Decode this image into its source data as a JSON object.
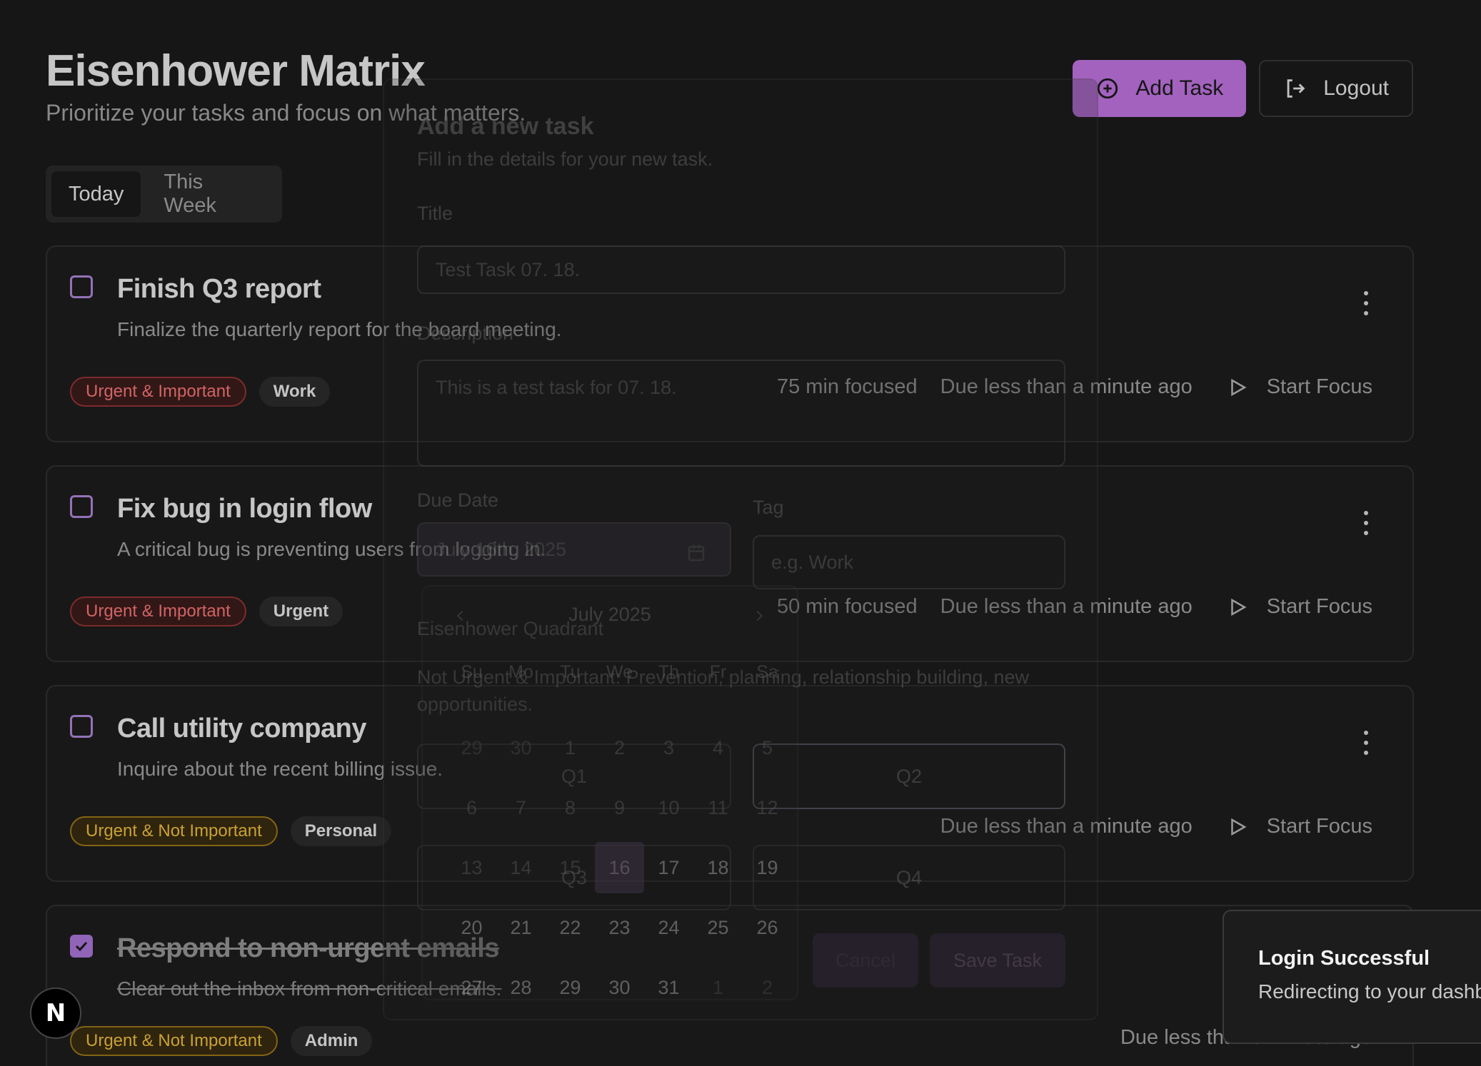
{
  "header": {
    "title": "Eisenhower Matrix",
    "subtitle": "Prioritize your tasks and focus on what matters.",
    "add_task_label": "Add Task",
    "logout_label": "Logout"
  },
  "tabs": [
    {
      "label": "Today",
      "active": true
    },
    {
      "label": "This Week",
      "active": false
    }
  ],
  "tasks": [
    {
      "title": "Finish Q3 report",
      "description": "Finalize the quarterly report for the board meeting.",
      "quadrant": "Urgent & Important",
      "tag": "Work",
      "focused": "75 min focused",
      "due": "Due less than a minute ago",
      "action": "Start Focus",
      "done": false
    },
    {
      "title": "Fix bug in login flow",
      "description": "A critical bug is preventing users from logging in.",
      "quadrant": "Urgent & Important",
      "tag": "Urgent",
      "focused": "50 min focused",
      "due": "Due less than a minute ago",
      "action": "Start Focus",
      "done": false
    },
    {
      "title": "Call utility company",
      "description": "Inquire about the recent billing issue.",
      "quadrant": "Urgent & Not Important",
      "tag": "Personal",
      "focused": "",
      "due": "Due less than a minute ago",
      "action": "Start Focus",
      "done": false
    },
    {
      "title": "Respond to non-urgent emails",
      "description": "Clear out the inbox from non-critical emails.",
      "quadrant": "Urgent & Not Important",
      "tag": "Admin",
      "due": "Due less than a minute ago",
      "done": true
    }
  ],
  "dialog": {
    "title": "Add a new task",
    "subtitle": "Fill in the details for your new task.",
    "title_label": "Title",
    "title_value": "Test Task 07. 18.",
    "description_label": "Description",
    "description_value": "This is a test task for 07. 18.",
    "due_date_label": "Due Date",
    "due_date_value": "July 16th, 2025",
    "tag_label": "Tag",
    "tag_placeholder": "e.g. Work",
    "quadrant_label": "Eisenhower Quadrant",
    "quadrant_help": "Not Urgent & Important: Prevention, planning, relationship building, new opportunities.",
    "quadrants": [
      "Q1",
      "Q2",
      "Q3",
      "Q4"
    ],
    "cancel_label": "Cancel",
    "save_label": "Save Task"
  },
  "calendar": {
    "month": "July 2025",
    "weekdays": [
      "Su",
      "Mo",
      "Tu",
      "We",
      "Th",
      "Fr",
      "Sa"
    ],
    "days": [
      "29",
      "30",
      "1",
      "2",
      "3",
      "4",
      "5",
      "6",
      "7",
      "8",
      "9",
      "10",
      "11",
      "12",
      "13",
      "14",
      "15",
      "16",
      "17",
      "18",
      "19",
      "20",
      "21",
      "22",
      "23",
      "24",
      "25",
      "26",
      "27",
      "28",
      "29",
      "30",
      "31",
      "1",
      "2"
    ],
    "selected": "16"
  },
  "toast": {
    "title": "Login Successful",
    "message": "Redirecting to your dashboard..."
  },
  "next_badge": "N",
  "colors": {
    "accent": "#c678e8",
    "background": "#1c1c1c",
    "urgent_important": "#ff7a7a",
    "urgent_not_important": "#f5c542"
  }
}
